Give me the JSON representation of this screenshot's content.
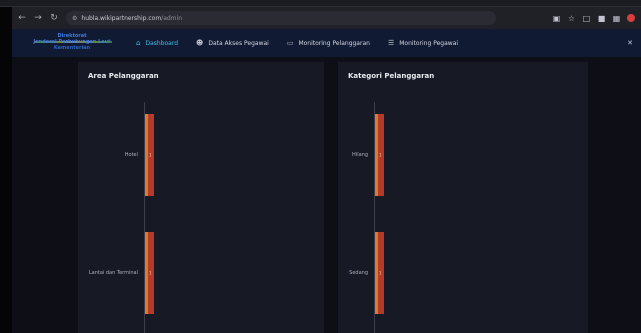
{
  "browser": {
    "url": "hubla.wikipartnership.com",
    "url_path": "/admin",
    "controls": [
      "back-icon",
      "forward-icon",
      "refresh-icon"
    ],
    "right_icons": [
      "translate-icon",
      "star-icon",
      "extension-icon",
      "profile-icon"
    ]
  },
  "nav": {
    "logo": {
      "line1": "Direktorat",
      "line2": "Jenderal Perhubungan Laut",
      "line3": "Kementerian"
    },
    "items": [
      {
        "label": "Dashboard",
        "icon": "home-icon",
        "active": true
      },
      {
        "label": "Data Akses Pegawai",
        "icon": "users-icon",
        "active": false
      },
      {
        "label": "Monitoring Pelanggaran",
        "icon": "clipboard-icon",
        "active": false
      },
      {
        "label": "Monitoring Pegawai",
        "icon": "list-icon",
        "active": false
      }
    ]
  },
  "panels": {
    "area": {
      "title": "Area Pelanggaran",
      "chart_data": {
        "type": "bar",
        "orientation": "horizontal",
        "title": "Area Pelanggaran",
        "categories": [
          "Hotel",
          "Lantai dan Terminal"
        ],
        "values": [
          1,
          1
        ],
        "colors": [
          "#b43a2a",
          "#e07a2a"
        ]
      }
    },
    "kategori": {
      "title": "Kategori Pelanggaran",
      "chart_data": {
        "type": "bar",
        "orientation": "horizontal",
        "title": "Kategori Pelanggaran",
        "categories": [
          "Hilang",
          "Sedang"
        ],
        "values": [
          1,
          1
        ],
        "colors": [
          "#b43a2a",
          "#e07a2a"
        ]
      }
    }
  }
}
